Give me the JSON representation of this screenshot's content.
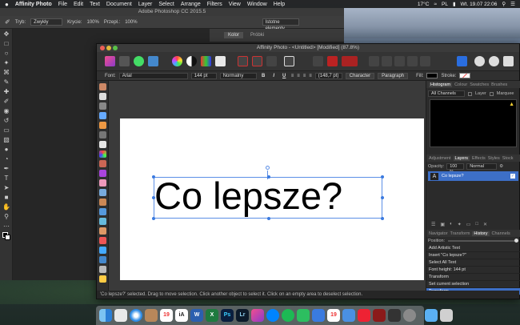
{
  "menubar": {
    "apple": "",
    "app_name": "Affinity Photo",
    "items": [
      "File",
      "Edit",
      "Text",
      "Document",
      "Layer",
      "Select",
      "Arrange",
      "Filters",
      "View",
      "Window",
      "Help"
    ],
    "status": {
      "temp": "17°C",
      "locale": "PL",
      "clock": "Wt. 19.07  22:06",
      "search_icon": "search-icon",
      "menu_icon": "list-icon"
    }
  },
  "photoshop": {
    "title": "Adobe Photoshop CC 2015.5",
    "options": {
      "mode_label": "Tryb:",
      "mode_value": "Zwykły",
      "opacity_label": "Krycie:",
      "opacity_value": "100%",
      "flow_label": "Przepł.:",
      "flow_value": "100%",
      "preset": "Istotne elementy"
    },
    "panel_tabs": [
      "Kolor",
      "Próbki"
    ]
  },
  "affinity": {
    "title": "Affinity Photo - <Untitled> [Modified] (87.8%)",
    "context": {
      "font_label": "Font:",
      "font_value": "Arial",
      "size_value": "144 pt",
      "style_value": "Normalny",
      "bold": "B",
      "italic": "I",
      "underline": "U",
      "leading_value": "(148,7 pt)",
      "character_btn": "Character",
      "paragraph_btn": "Paragraph",
      "fill_label": "Fill:",
      "stroke_label": "Stroke:"
    },
    "canvas_text": "Co lepsze?",
    "status_text": "'Co lepsze?' selected. Drag to move selection. Click another object to select it. Click on an empty area to deselect selection.",
    "panels": {
      "top_tabs": [
        "Histogram",
        "Colour",
        "Swatches",
        "Brushes"
      ],
      "channels_value": "All Channels",
      "layer_label": "Layer",
      "marquee_label": "Marquee",
      "layer_tabs": [
        "Adjustment",
        "Layers",
        "Effects",
        "Styles",
        "Stock"
      ],
      "opacity_label": "Opacity:",
      "opacity_value": "100 %",
      "blend_value": "Normal",
      "layer_name": "Co lepsze?",
      "history_tabs": [
        "Navigator",
        "Transform",
        "History",
        "Channels"
      ],
      "position_label": "Position:",
      "history": [
        "Add Artistic Text",
        "Insert \"Co lepsze?\"",
        "Select All Text",
        "Font height: 144 pt",
        "Transform",
        "Set current selection",
        "Transform"
      ]
    }
  },
  "dock": [
    "Finder",
    "Preview",
    "Safari",
    "Contacts",
    "Calendar",
    "iA Writer",
    "Word",
    "Excel",
    "Photoshop",
    "Lightroom",
    "Affinity Photo",
    "Messenger",
    "Spotify",
    "Evernote",
    "Airmail",
    "Calendar 2",
    "Things",
    "Wunderlist",
    "Photo Booth",
    "Activity Monitor",
    "System Preferences",
    "Downloads",
    "Trash"
  ]
}
